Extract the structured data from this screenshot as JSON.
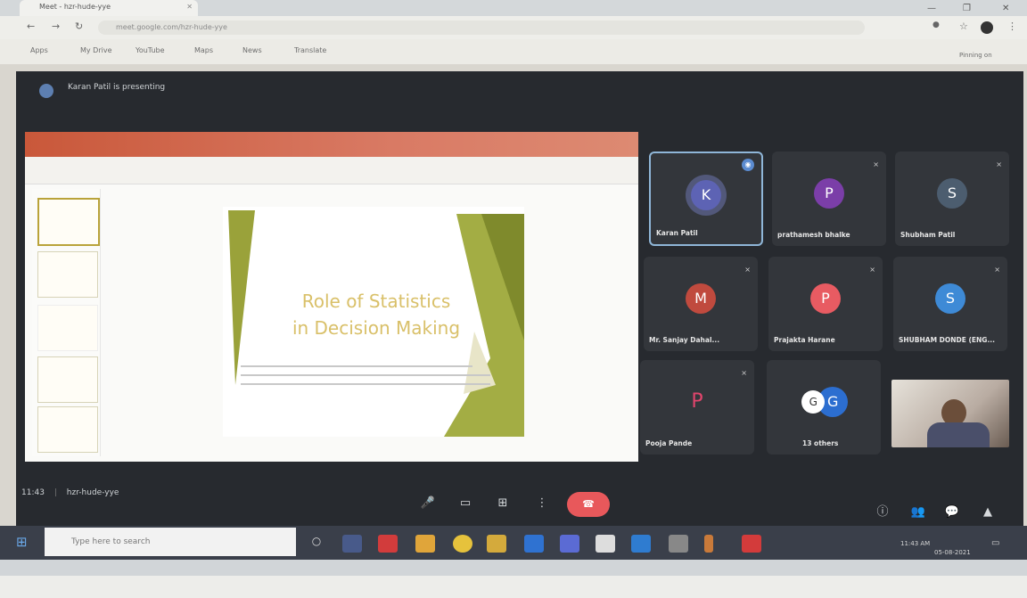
{
  "browser": {
    "tab_title": "Meet - hzr-hude-yye",
    "url": "meet.google.com/hzr-hude-yye",
    "bookmarks": [
      "Apps",
      "My Drive",
      "YouTube",
      "Maps",
      "News",
      "Translate"
    ],
    "window_controls": [
      "—",
      "❐",
      "✕"
    ]
  },
  "meet": {
    "presenting_label": "Karan Patil is presenting",
    "time_label": "11:43",
    "meeting_code": "hzr-hude-yye",
    "pinned_label": "Pinning on"
  },
  "slide": {
    "title_line1": "Role of Statistics",
    "title_line2": "in Decision Making"
  },
  "participants": [
    {
      "name": "Karan Patil",
      "initial": "K",
      "color": "#5d63b4",
      "active": true
    },
    {
      "name": "prathamesh bhalke",
      "initial": "P",
      "color": "#7b3ea8"
    },
    {
      "name": "Shubham Patil",
      "initial": "S",
      "color": "#4c5d6f"
    },
    {
      "name": "Mr. Sanjay Dahal...",
      "initial": "M",
      "color": "#c04a3e"
    },
    {
      "name": "Prajakta Harane",
      "initial": "P",
      "color": "#e85b62"
    },
    {
      "name": "SHUBHAM DONDE (ENG...",
      "initial": "S",
      "color": "#3e8ad6"
    },
    {
      "name": "Pooja Pande",
      "initial": "P",
      "color": "#e0456c"
    },
    {
      "name": "13 others",
      "initial": "G",
      "color": "#2c6ed0"
    },
    {
      "name": "",
      "initial": "",
      "color": "#9a8f86",
      "video": true
    }
  ],
  "controls": {
    "mic_icon": "🎤",
    "cam_icon": "▭",
    "present_icon": "⊞",
    "more_icon": "⋮",
    "end_icon": "☎"
  },
  "taskbar": {
    "search_placeholder": "Type here to search",
    "clock_time": "11:43 AM",
    "clock_date": "05-08-2021"
  },
  "colors": {
    "meet_bg": "#272a2f",
    "end_call": "#e8585b",
    "slide_accent": "#a0a93b",
    "slide_title": "#d9c069"
  }
}
